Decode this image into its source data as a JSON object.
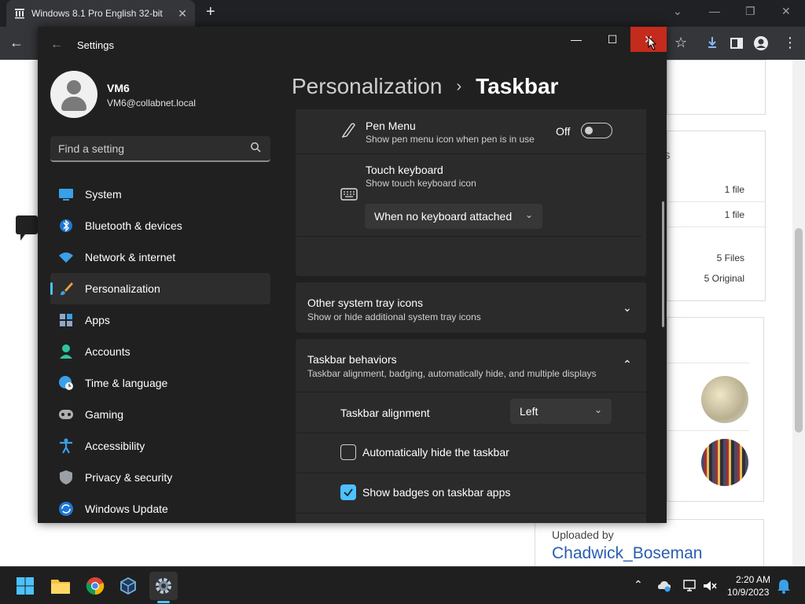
{
  "browser": {
    "tab_title": "Windows 8.1 Pro English 32-bit",
    "tab_close": "✕",
    "new_tab": "+"
  },
  "webpage": {
    "rows": [
      {
        "value": "1 file"
      },
      {
        "value": "1 file"
      },
      {
        "value": "5 Files"
      },
      {
        "value": "5 Original"
      }
    ],
    "partial_header": "s",
    "uploaded_by_label": "Uploaded by",
    "uploader_name": "Chadwick_Boseman"
  },
  "settings": {
    "app_title": "Settings",
    "user": {
      "name": "VM6",
      "email": "VM6@collabnet.local"
    },
    "search": {
      "placeholder": "Find a setting"
    },
    "nav": [
      {
        "label": "System",
        "icon": "system-icon"
      },
      {
        "label": "Bluetooth & devices",
        "icon": "bluetooth-icon"
      },
      {
        "label": "Network & internet",
        "icon": "wifi-icon"
      },
      {
        "label": "Personalization",
        "icon": "brush-icon",
        "selected": true
      },
      {
        "label": "Apps",
        "icon": "apps-icon"
      },
      {
        "label": "Accounts",
        "icon": "accounts-icon"
      },
      {
        "label": "Time & language",
        "icon": "clock-globe-icon"
      },
      {
        "label": "Gaming",
        "icon": "gamepad-icon"
      },
      {
        "label": "Accessibility",
        "icon": "accessibility-icon"
      },
      {
        "label": "Privacy & security",
        "icon": "shield-icon"
      },
      {
        "label": "Windows Update",
        "icon": "update-icon"
      }
    ],
    "breadcrumb": {
      "parent": "Personalization",
      "separator": "›",
      "current": "Taskbar"
    },
    "content": {
      "pen_menu": {
        "title": "Pen Menu",
        "subtitle": "Show pen menu icon when pen is in use",
        "state": "Off"
      },
      "touch_keyboard": {
        "title": "Touch keyboard",
        "subtitle": "Show touch keyboard icon",
        "selected": "When no keyboard attached"
      },
      "tray_icons": {
        "title": "Other system tray icons",
        "subtitle": "Show or hide additional system tray icons"
      },
      "behaviors": {
        "title": "Taskbar behaviors",
        "subtitle": "Taskbar alignment, badging, automatically hide, and multiple displays"
      },
      "alignment": {
        "label": "Taskbar alignment",
        "value": "Left"
      },
      "auto_hide": {
        "label": "Automatically hide the taskbar",
        "checked": false
      },
      "badges": {
        "label": "Show badges on taskbar apps",
        "checked": true
      }
    }
  },
  "taskbar": {
    "time": "2:20 AM",
    "date": "10/9/2023"
  },
  "colors": {
    "accent": "#4cc2ff",
    "close_red": "#c42b1c",
    "link_blue": "#2a5db0"
  }
}
